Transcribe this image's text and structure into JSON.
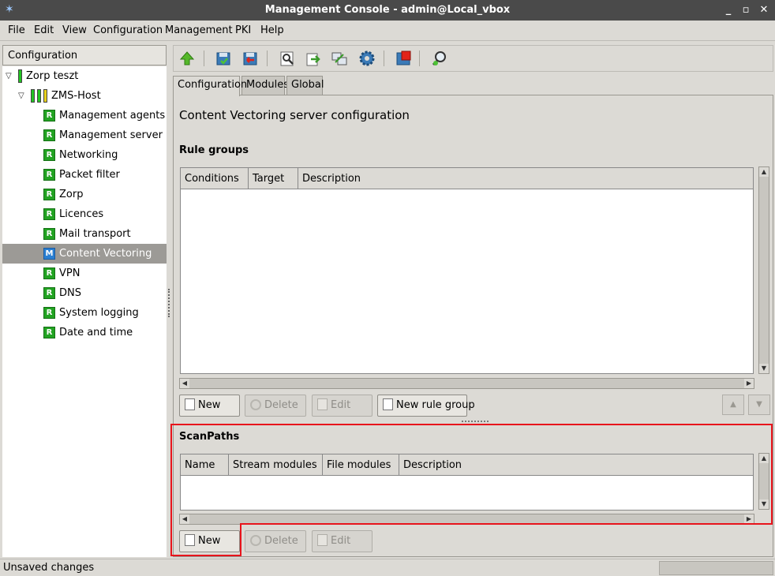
{
  "window": {
    "title": "Management Console - admin@Local_vbox"
  },
  "menu": [
    "File",
    "Edit",
    "View",
    "Configuration",
    "Management",
    "PKI",
    "Help"
  ],
  "left_panel": {
    "header": "Configuration",
    "tree": [
      {
        "label": "Zorp teszt"
      },
      {
        "label": "ZMS-Host"
      },
      {
        "label": "Management agents",
        "badge": "R"
      },
      {
        "label": "Management server",
        "badge": "R"
      },
      {
        "label": "Networking",
        "badge": "R"
      },
      {
        "label": "Packet filter",
        "badge": "R"
      },
      {
        "label": "Zorp",
        "badge": "R"
      },
      {
        "label": "Licences",
        "badge": "R"
      },
      {
        "label": "Mail transport",
        "badge": "R"
      },
      {
        "label": "Content Vectoring",
        "badge": "M",
        "selected": true
      },
      {
        "label": "VPN",
        "badge": "R"
      },
      {
        "label": "DNS",
        "badge": "R"
      },
      {
        "label": "System logging",
        "badge": "R"
      },
      {
        "label": "Date and time",
        "badge": "R"
      }
    ]
  },
  "toolbar": {
    "icons": [
      "up-arrow-icon",
      "commit-icon",
      "revert-icon",
      "view-icon",
      "upload-icon",
      "transfer-icon",
      "settings-gear-icon",
      "stop-icon",
      "search-key-icon"
    ]
  },
  "tabs": [
    "Configuration",
    "Modules",
    "Global"
  ],
  "main": {
    "title": "Content Vectoring server configuration",
    "rule_groups": {
      "title": "Rule groups",
      "columns": [
        "Conditions",
        "Target",
        "Description"
      ],
      "buttons": {
        "new": "New",
        "delete": "Delete",
        "edit": "Edit",
        "new_rule_group": "New rule group"
      }
    },
    "scanpaths": {
      "title": "ScanPaths",
      "columns": [
        "Name",
        "Stream modules",
        "File modules",
        "Description"
      ],
      "buttons": {
        "new": "New",
        "delete": "Delete",
        "edit": "Edit"
      }
    }
  },
  "status": {
    "text": "Unsaved changes"
  },
  "colors": {
    "highlight": "#e8141c",
    "titlebar": "#4a4a4a",
    "selected_row": "#9c9a96",
    "badge_green": "#22a322",
    "badge_blue": "#2a7fd2"
  }
}
